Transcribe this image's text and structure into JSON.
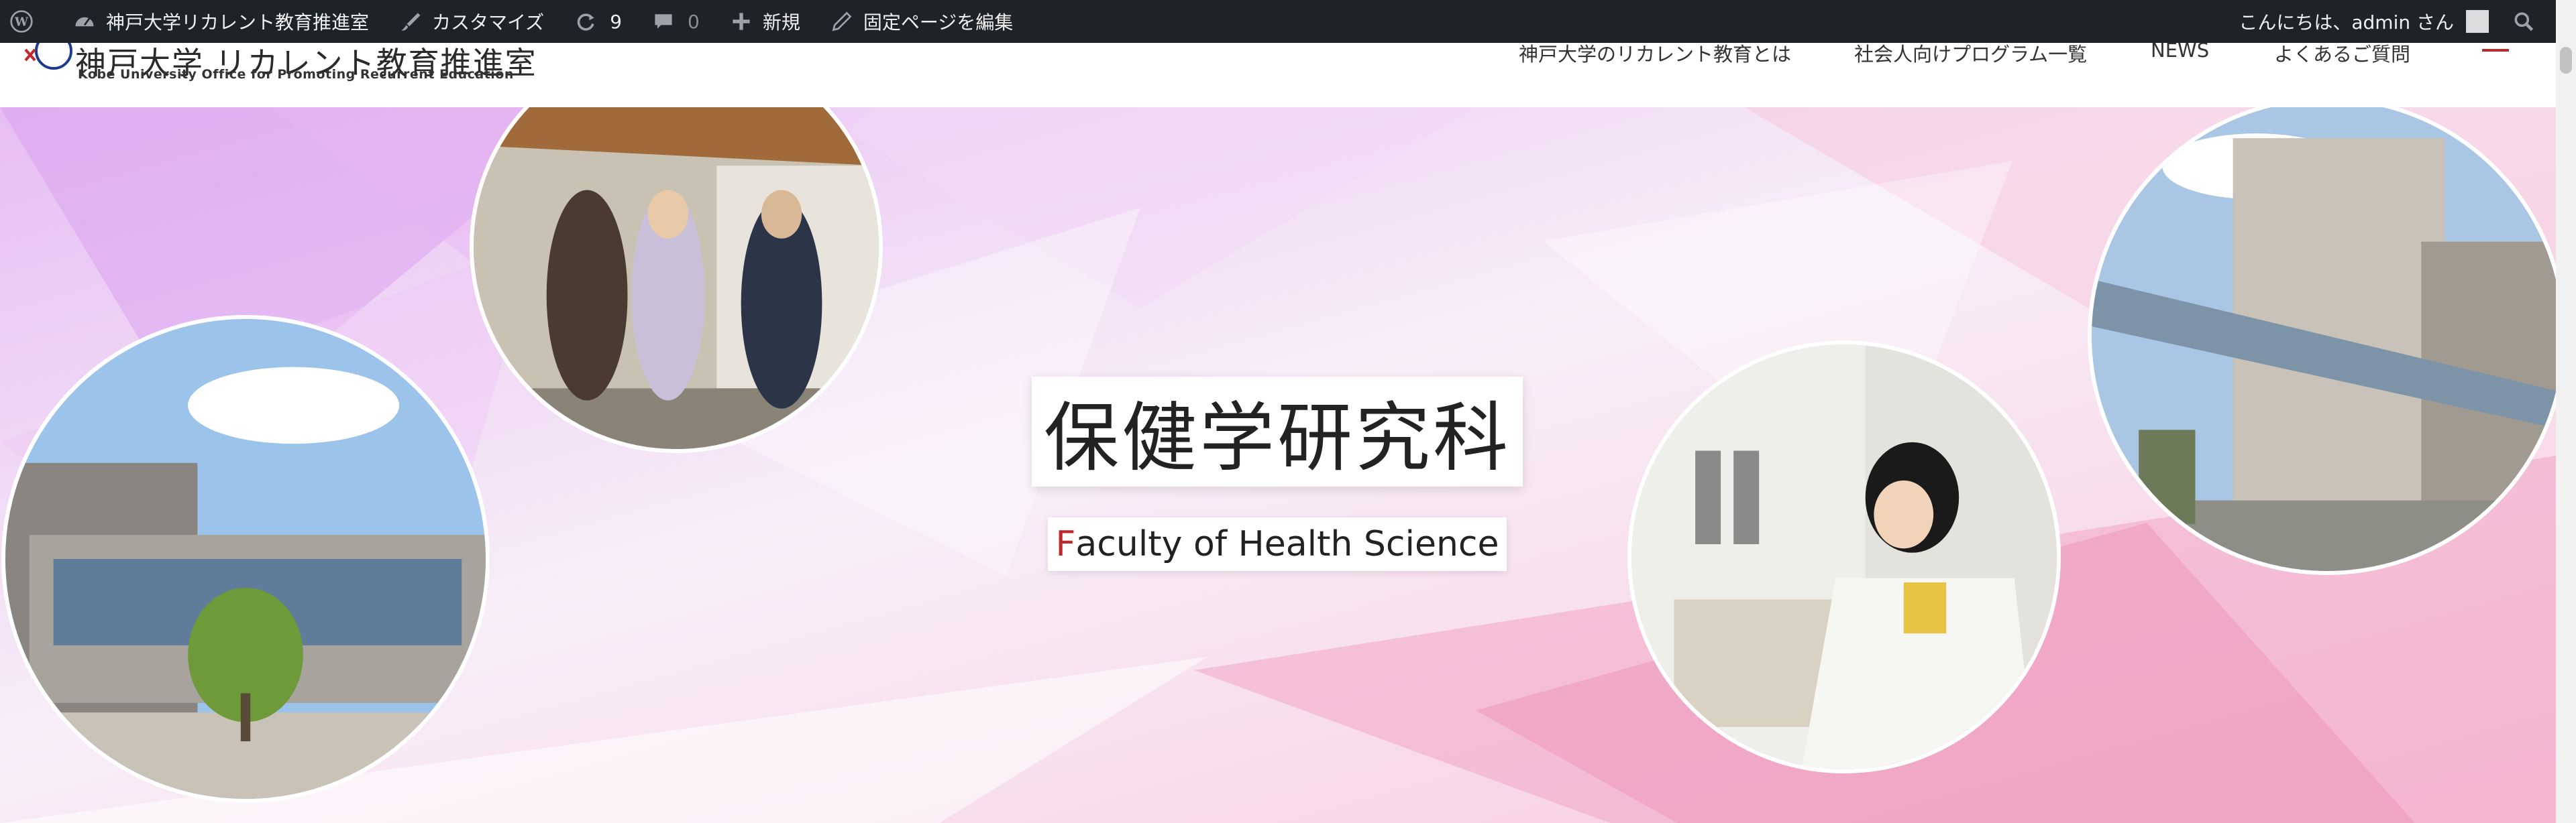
{
  "adminbar": {
    "site_name": "神戸大学リカレント教育推進室",
    "customize": "カスタマイズ",
    "updates_count": "9",
    "comments_count": "0",
    "new_label": "新規",
    "edit_page": "固定ページを編集",
    "greeting": "こんにちは、admin さん"
  },
  "header": {
    "logo_title": "神戸大学 リカレント教育推進室",
    "logo_subtitle": "Kobe University Office for Promoting Recurrent Education",
    "nav": [
      "神戸大学のリカレント教育とは",
      "社会人向けプログラム一覧",
      "NEWS",
      "よくあるご質問"
    ]
  },
  "hero": {
    "title": "保健学研究科",
    "subtitle_first_letter": "F",
    "subtitle_rest": "aculty of Health Science"
  },
  "colors": {
    "admin_bar": "#1d2327",
    "accent_red": "#c0282e",
    "hero_pink": "#f3b7d5",
    "hero_purple": "#d79af0"
  },
  "icons": [
    "wordpress-icon",
    "dashboard-icon",
    "brush-icon",
    "updates-icon",
    "comment-icon",
    "plus-icon",
    "pencil-icon",
    "search-icon",
    "menu-icon"
  ]
}
